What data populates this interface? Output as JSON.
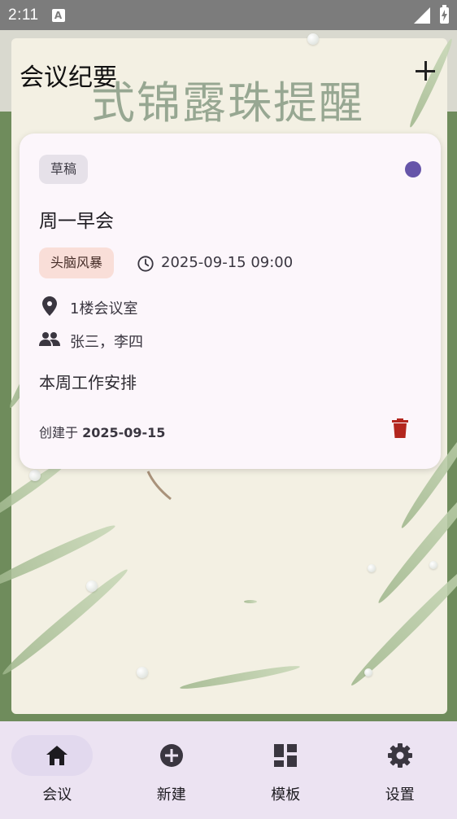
{
  "status_bar": {
    "time": "2:11",
    "notification_badge": "A"
  },
  "background": {
    "watermark": "式锦露珠提醒"
  },
  "app_bar": {
    "title": "会议纪要",
    "add_icon": "plus-icon"
  },
  "meeting_card": {
    "status_chip": "草稿",
    "status_dot_color": "#6655a9",
    "title": "周一早会",
    "type_chip": "头脑风暴",
    "datetime": "2025-09-15 09:00",
    "location": "1楼会议室",
    "participants": "张三，李四",
    "summary": "本周工作安排",
    "created_prefix": "创建于 ",
    "created_date": "2025-09-15",
    "delete_icon": "trash-icon",
    "delete_color": "#b3261e"
  },
  "bottom_nav": {
    "items": [
      {
        "label": "会议",
        "icon": "home-icon",
        "active": true
      },
      {
        "label": "新建",
        "icon": "add-circle-icon",
        "active": false
      },
      {
        "label": "模板",
        "icon": "dashboard-icon",
        "active": false
      },
      {
        "label": "设置",
        "icon": "settings-icon",
        "active": false
      }
    ]
  }
}
